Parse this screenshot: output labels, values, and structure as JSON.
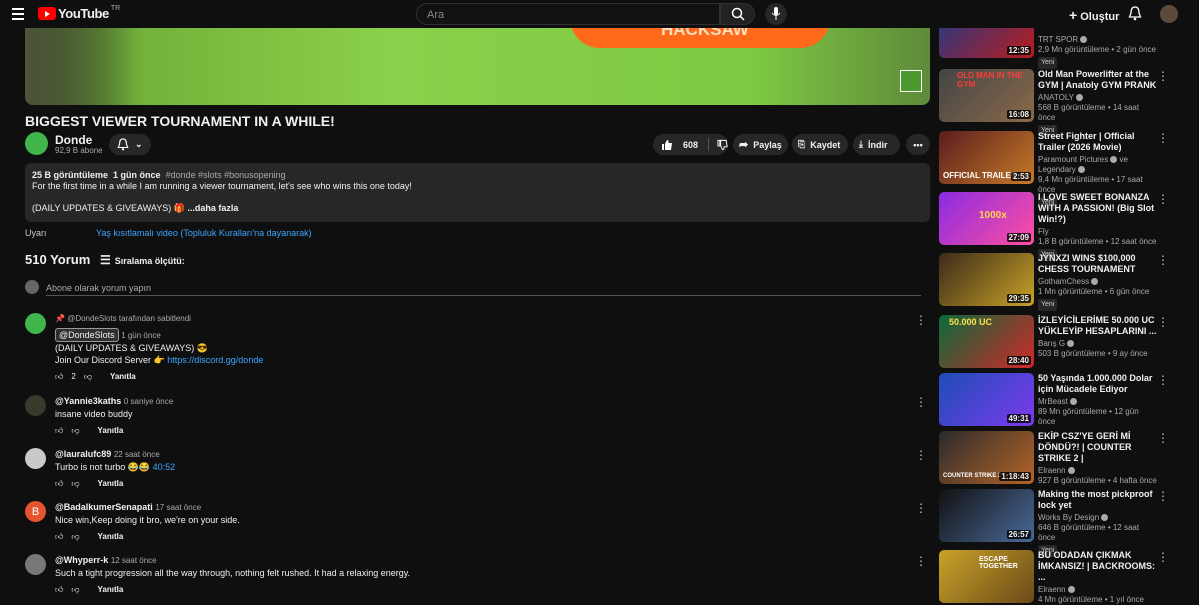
{
  "header": {
    "logo_text": "YouTube",
    "logo_region": "TR",
    "search_placeholder": "Ara",
    "create_label": "Oluştur"
  },
  "video": {
    "title": "BIGGEST VIEWER TOURNAMENT IN A WHILE!",
    "player_text": "HACKSAW",
    "channel": "Donde",
    "subs": "92,9 B abone",
    "likes": "608",
    "share": "Paylaş",
    "save": "Kaydet",
    "download": "İndir"
  },
  "description": {
    "views": "25 B görüntüleme",
    "time": "1 gün önce",
    "hashtags": "#donde #slots #bonusopening",
    "line1": "For the first time in a while I am running a viewer tournament, let's see who wins this one today!",
    "line2": "(DAILY UPDATES & GIVEAWAYS) 🎁",
    "more": "...daha fazla"
  },
  "warning": {
    "label": "Uyarı",
    "text": "Yaş kısıtlamalı video (Topluluk Kuralları'na dayanarak)"
  },
  "comments_header": {
    "count": "510 Yorum",
    "sort": "Sıralama ölçütü:",
    "add_placeholder": "Abone olarak yorum yapın"
  },
  "comments": [
    {
      "pinned": "@DondeSlots tarafından sabitlendi",
      "author": "@DondeSlots",
      "time": "1 gün önce",
      "line1": "(DAILY UPDATES & GIVEAWAYS) 😎",
      "line2a": "Join Our Discord Server 👉",
      "link": "https://discord.gg/donde",
      "likes": "2",
      "reply": "Yanıtla"
    },
    {
      "author": "@Yannie3kaths",
      "time": "0 saniye önce",
      "text": "insane video buddy",
      "reply": "Yanıtla"
    },
    {
      "author": "@lauralufc89",
      "time": "22 saat önce",
      "text": "Turbo is not turbo 😂😂",
      "timestamp": "40:52",
      "reply": "Yanıtla"
    },
    {
      "author": "@BadalkumerSenapati",
      "time": "17 saat önce",
      "text": "Nice win,Keep doing it bro, we're on your side.",
      "avatar_letter": "B",
      "reply": "Yanıtla"
    },
    {
      "author": "@Whyperr-k",
      "time": "12 saat önce",
      "text": "Such a tight progression all the way through, nothing felt rushed. It had a relaxing energy.",
      "reply": "Yanıtla"
    }
  ],
  "recommendations": [
    {
      "title": "",
      "channel": "TRT SPOR",
      "meta": "2,9 Mn görüntüleme • 2 gün önce",
      "badge": "Yeni",
      "duration": "12:35"
    },
    {
      "title": "Old Man Powerlifter at the GYM | Anatoly GYM PRANK",
      "channel": "ANATOLY",
      "meta": "568 B görüntüleme • 14 saat önce",
      "badge": "Yeni",
      "duration": "16:08",
      "thumb_text": "OLD MAN IN THE GYM"
    },
    {
      "title": "Street Fighter | Official Trailer (2026 Movie)",
      "channel": "Paramount Pictures",
      "channel2": "ve Legendary",
      "meta": "9,4 Mn görüntüleme • 17 saat önce",
      "badge": "Yeni",
      "duration": "2:53",
      "thumb_text": "OFFICIAL TRAILER"
    },
    {
      "title": "I LOVE SWEET BONANZA WITH A PASSION! (Big Slot Win!?)",
      "channel": "Fly",
      "meta": "1,8 B görüntüleme • 12 saat önce",
      "badge": "Yeni",
      "duration": "27:09",
      "thumb_text": "1000x"
    },
    {
      "title": "JYNXZI WINS $100,000 CHESS TOURNAMENT",
      "channel": "GothamChess",
      "meta": "1 Mn görüntüleme • 6 gün önce",
      "badge": "Yeni",
      "duration": "29:35"
    },
    {
      "title": "İZLEYİCİLERİME 50.000 UC YÜKLEYİP HESAPLARINI ...",
      "channel": "Barış G",
      "meta": "503 B görüntüleme • 9 ay önce",
      "duration": "28:40",
      "thumb_text": "50.000 UC"
    },
    {
      "title": "50 Yaşında 1.000.000 Dolar için Mücadele Ediyor",
      "channel": "MrBeast",
      "meta": "89 Mn görüntüleme • 12 gün önce",
      "duration": "49:31"
    },
    {
      "title": "EKİP CSZ'YE GERİ Mİ DÖNDÜ?! | COUNTER STRIKE 2 |",
      "channel": "Elraenn",
      "meta": "927 B görüntüleme • 4 hafta önce",
      "duration": "1:18:43",
      "thumb_text": "COUNTER STRIKE 2"
    },
    {
      "title": "Making the most pickproof lock yet",
      "channel": "Works By Design",
      "meta": "646 B görüntüleme • 12 saat önce",
      "badge": "Yeni",
      "duration": "26:57"
    },
    {
      "title": "BU ODADAN ÇIKMAK İMKANSIZ! | BACKROOMS: ...",
      "channel": "Elraenn",
      "meta": "4 Mn görüntüleme • 1 yıl önce",
      "duration": "",
      "thumb_text": "ESCAPE TOGETHER"
    }
  ]
}
